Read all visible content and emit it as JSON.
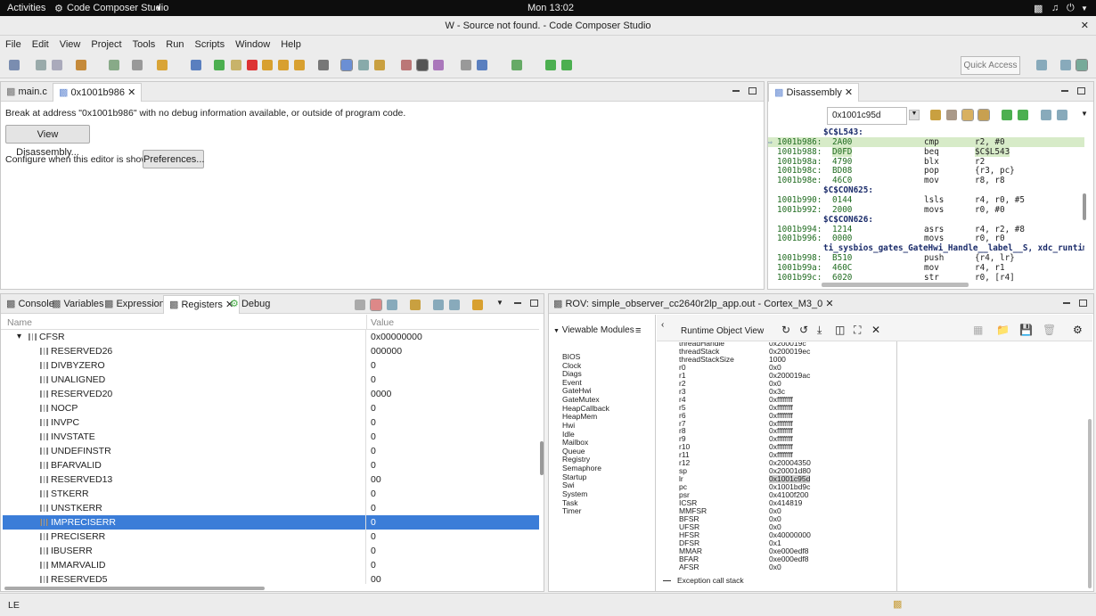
{
  "topbar": {
    "activities": "Activities",
    "app": "Code Composer Studio",
    "clock": "Mon 13:02"
  },
  "window": {
    "title": "W - Source not found. - Code Composer Studio"
  },
  "menu": [
    "File",
    "Edit",
    "View",
    "Project",
    "Tools",
    "Run",
    "Scripts",
    "Window",
    "Help"
  ],
  "quick_access": "Quick Access",
  "editor": {
    "tabs": [
      "main.c",
      "0x1001b986"
    ],
    "message": "Break at address \"0x1001b986\" with no debug information available, or outside of program code.",
    "view_disassembly": "View Disassembly...",
    "configure_text": "Configure when this editor is shown",
    "preferences": "Preferences..."
  },
  "disasm": {
    "tab": "Disassembly",
    "address": "0x1001c95d",
    "lines": [
      {
        "t": "label",
        "text": "$C$L543:"
      },
      {
        "t": "ins",
        "addr": "1001b986:",
        "op": "2A00",
        "mn": "cmp",
        "args": "r2, #0",
        "hl": true
      },
      {
        "t": "ins",
        "addr": "1001b988:",
        "op": "D0FD",
        "mn": "beq",
        "args": "$C$L543",
        "hl2": true
      },
      {
        "t": "ins",
        "addr": "1001b98a:",
        "op": "4790",
        "mn": "blx",
        "args": "r2"
      },
      {
        "t": "ins",
        "addr": "1001b98c:",
        "op": "BD08",
        "mn": "pop",
        "args": "{r3, pc}"
      },
      {
        "t": "ins",
        "addr": "1001b98e:",
        "op": "46C0",
        "mn": "mov",
        "args": "r8, r8"
      },
      {
        "t": "label",
        "text": "$C$CON625:"
      },
      {
        "t": "ins",
        "addr": "1001b990:",
        "op": "0144",
        "mn": "lsls",
        "args": "r4, r0, #5"
      },
      {
        "t": "ins",
        "addr": "1001b992:",
        "op": "2000",
        "mn": "movs",
        "args": "r0, #0"
      },
      {
        "t": "label",
        "text": "$C$CON626:"
      },
      {
        "t": "ins",
        "addr": "1001b994:",
        "op": "1214",
        "mn": "asrs",
        "args": "r4, r2, #8"
      },
      {
        "t": "ins",
        "addr": "1001b996:",
        "op": "0000",
        "mn": "movs",
        "args": "r0, r0"
      },
      {
        "t": "label2",
        "text": "ti_sysbios_gates_GateHwi_Handle__label__S, xdc_runtime_S"
      },
      {
        "t": "ins",
        "addr": "1001b998:",
        "op": "B510",
        "mn": "push",
        "args": "{r4, lr}"
      },
      {
        "t": "ins",
        "addr": "1001b99a:",
        "op": "460C",
        "mn": "mov",
        "args": "r4, r1"
      },
      {
        "t": "ins",
        "addr": "1001b99c:",
        "op": "6020",
        "mn": "str",
        "args": "r0, [r4]"
      }
    ]
  },
  "bottom_tabs": [
    "Console",
    "Variables",
    "Expressions",
    "Registers",
    "Debug"
  ],
  "registers": {
    "col_name": "Name",
    "col_value": "Value",
    "rows": [
      {
        "name": "CFSR",
        "value": "0x00000000",
        "parent": true
      },
      {
        "name": "RESERVED26",
        "value": "000000"
      },
      {
        "name": "DIVBYZERO",
        "value": "0"
      },
      {
        "name": "UNALIGNED",
        "value": "0"
      },
      {
        "name": "RESERVED20",
        "value": "0000"
      },
      {
        "name": "NOCP",
        "value": "0"
      },
      {
        "name": "INVPC",
        "value": "0"
      },
      {
        "name": "INVSTATE",
        "value": "0"
      },
      {
        "name": "UNDEFINSTR",
        "value": "0"
      },
      {
        "name": "BFARVALID",
        "value": "0"
      },
      {
        "name": "RESERVED13",
        "value": "00"
      },
      {
        "name": "STKERR",
        "value": "0"
      },
      {
        "name": "UNSTKERR",
        "value": "0"
      },
      {
        "name": "IMPRECISERR",
        "value": "0",
        "selected": true
      },
      {
        "name": "PRECISERR",
        "value": "0"
      },
      {
        "name": "IBUSERR",
        "value": "0"
      },
      {
        "name": "MMARVALID",
        "value": "0"
      },
      {
        "name": "RESERVED5",
        "value": "00"
      }
    ]
  },
  "rov": {
    "tab": "ROV: simple_observer_cc2640r2lp_app.out - Cortex_M3_0",
    "viewable_modules": "Viewable Modules",
    "runtime_view": "Runtime Object View",
    "modules": [
      "BIOS",
      "Clock",
      "Diags",
      "Event",
      "GateHwi",
      "GateMutex",
      "HeapCallback",
      "HeapMem",
      "Hwi",
      "Idle",
      "Mailbox",
      "Queue",
      "Registry",
      "Semaphore",
      "Startup",
      "Swi",
      "System",
      "Task",
      "Timer"
    ],
    "rows": [
      {
        "k": "threadHandle",
        "v": "0x200019c"
      },
      {
        "k": "threadStack",
        "v": "0x200019ec"
      },
      {
        "k": "threadStackSize",
        "v": "1000"
      },
      {
        "k": "r0",
        "v": "0x0"
      },
      {
        "k": "r1",
        "v": "0x200019ac"
      },
      {
        "k": "r2",
        "v": "0x0"
      },
      {
        "k": "r3",
        "v": "0x3c"
      },
      {
        "k": "r4",
        "v": "0xffffffff"
      },
      {
        "k": "r5",
        "v": "0xffffffff"
      },
      {
        "k": "r6",
        "v": "0xffffffff"
      },
      {
        "k": "r7",
        "v": "0xffffffff"
      },
      {
        "k": "r8",
        "v": "0xffffffff"
      },
      {
        "k": "r9",
        "v": "0xffffffff"
      },
      {
        "k": "r10",
        "v": "0xffffffff"
      },
      {
        "k": "r11",
        "v": "0xffffffff"
      },
      {
        "k": "r12",
        "v": "0x20004350"
      },
      {
        "k": "sp",
        "v": "0x20001d80"
      },
      {
        "k": "lr",
        "v": "0x1001c95d",
        "hl": true
      },
      {
        "k": "pc",
        "v": "0x1001bd9c"
      },
      {
        "k": "psr",
        "v": "0x4100f200"
      },
      {
        "k": "ICSR",
        "v": "0x414819"
      },
      {
        "k": "MMFSR",
        "v": "0x0"
      },
      {
        "k": "BFSR",
        "v": "0x0"
      },
      {
        "k": "UFSR",
        "v": "0x0"
      },
      {
        "k": "HFSR",
        "v": "0x40000000"
      },
      {
        "k": "DFSR",
        "v": "0x1"
      },
      {
        "k": "MMAR",
        "v": "0xe000edf8"
      },
      {
        "k": "BFAR",
        "v": "0xe000edf8"
      },
      {
        "k": "AFSR",
        "v": "0x0"
      }
    ],
    "exception": "Exception call stack"
  },
  "status": {
    "mode": "LE"
  }
}
